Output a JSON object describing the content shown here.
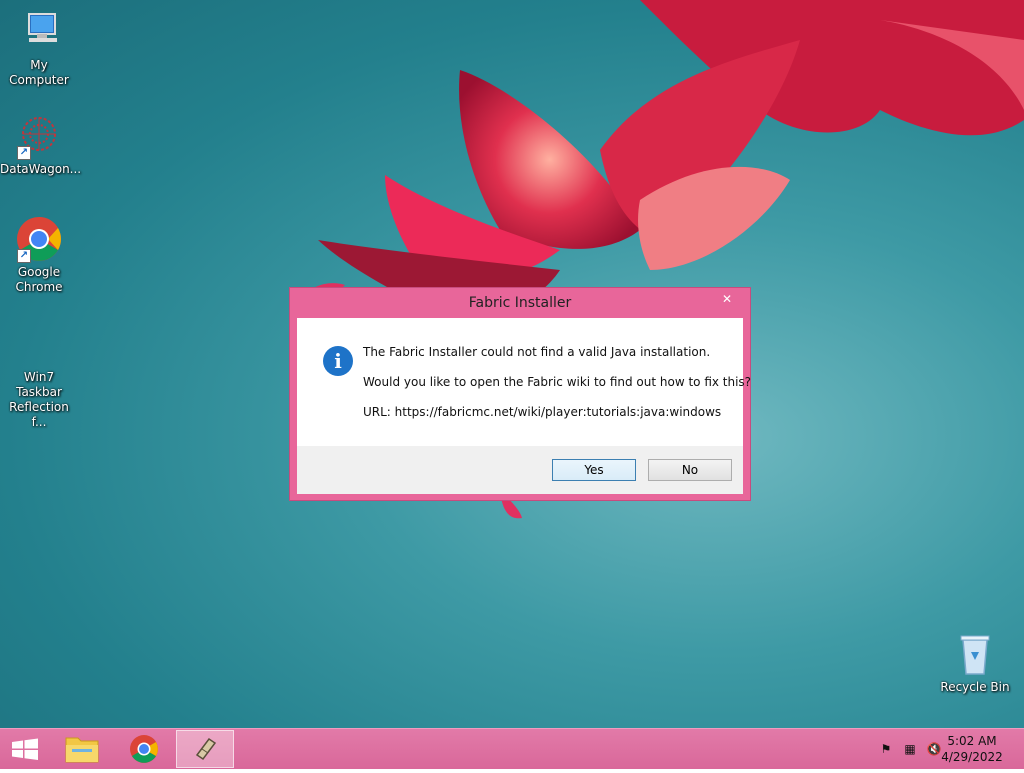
{
  "desktop": {
    "icons": [
      {
        "label": "My Computer",
        "icon": "computer-icon"
      },
      {
        "label": "DataWagon...",
        "icon": "datawagon-icon"
      },
      {
        "label": "Google Chrome",
        "icon": "chrome-icon"
      },
      {
        "label": "Win7 Taskbar Reflection f...",
        "icon": "blank-app-icon"
      },
      {
        "label": "Recycle Bin",
        "icon": "recycle-bin-icon"
      }
    ]
  },
  "dialog": {
    "title": "Fabric Installer",
    "close_label": "✕",
    "message_line1": "The Fabric Installer could not find a valid Java installation.",
    "message_line2": "Would you like to open the Fabric wiki to find out how to fix this?",
    "message_line3": "URL: https://fabricmc.net/wiki/player:tutorials:java:windows",
    "yes_label": "Yes",
    "no_label": "No"
  },
  "taskbar": {
    "items": [
      {
        "icon": "start-windows-icon"
      },
      {
        "icon": "file-explorer-icon"
      },
      {
        "icon": "chrome-icon"
      },
      {
        "icon": "fabric-installer-icon",
        "active": true
      }
    ],
    "tray": {
      "time": "5:02 AM",
      "date": "4/29/2022"
    }
  },
  "colors": {
    "accent": "#e8669a",
    "taskbar": "#dc6c9e",
    "info_icon": "#1e73c8",
    "desktop": "#2a8a97"
  }
}
